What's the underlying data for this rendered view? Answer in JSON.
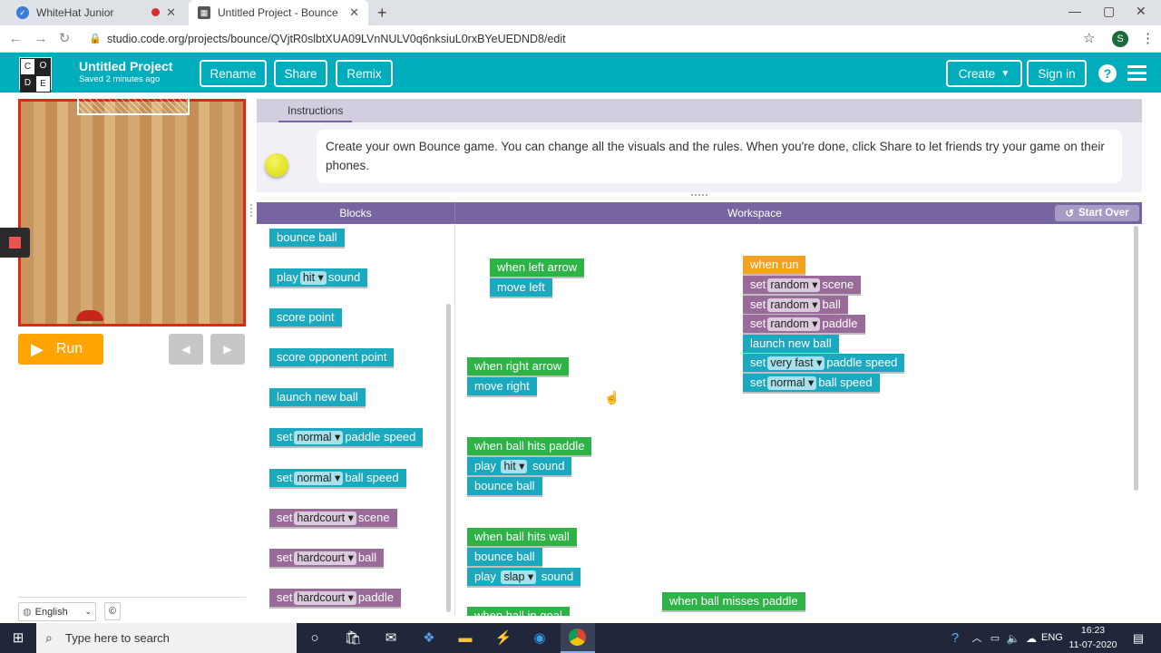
{
  "browser": {
    "tabs": [
      {
        "title": "WhiteHat Junior",
        "recording_dot": true
      },
      {
        "title": "Untitled Project - Bounce"
      }
    ],
    "url": "studio.code.org/projects/bounce/QVjtR0slbtXUA09LVnNULV0q6nksiuL0rxBYeUEDND8/edit",
    "profile_initial": "S"
  },
  "header": {
    "logo_letters": [
      "C",
      "O",
      "D",
      "E"
    ],
    "project_title": "Untitled Project",
    "saved_status": "Saved 2 minutes ago",
    "rename_label": "Rename",
    "share_label": "Share",
    "remix_label": "Remix",
    "create_label": "Create",
    "signin_label": "Sign in"
  },
  "game": {
    "run_label": "Run"
  },
  "instructions": {
    "tab_label": "Instructions",
    "text": "Create your own Bounce game. You can change all the visuals and the rules. When you're done, click Share to let friends try your game on their phones."
  },
  "panels": {
    "blocks_label": "Blocks",
    "workspace_label": "Workspace",
    "start_over_label": "Start Over"
  },
  "toolbox": [
    {
      "pre": "bounce ball",
      "dd": "",
      "post": "",
      "color": "teal"
    },
    {
      "pre": "play",
      "dd": "hit",
      "post": "sound",
      "color": "teal"
    },
    {
      "pre": "score point",
      "dd": "",
      "post": "",
      "color": "teal"
    },
    {
      "pre": "score opponent point",
      "dd": "",
      "post": "",
      "color": "teal"
    },
    {
      "pre": "launch new ball",
      "dd": "",
      "post": "",
      "color": "teal"
    },
    {
      "pre": "set",
      "dd": "normal",
      "post": "paddle speed",
      "color": "teal"
    },
    {
      "pre": "set",
      "dd": "normal",
      "post": "ball speed",
      "color": "teal"
    },
    {
      "pre": "set",
      "dd": "hardcourt",
      "post": "scene",
      "color": "purple"
    },
    {
      "pre": "set",
      "dd": "hardcourt",
      "post": "ball",
      "color": "purple"
    },
    {
      "pre": "set",
      "dd": "hardcourt",
      "post": "paddle",
      "color": "purple"
    }
  ],
  "workspace": {
    "left_arrow": {
      "event": "when left arrow",
      "action": "move left"
    },
    "right_arrow": {
      "event": "when right arrow",
      "action": "move right"
    },
    "run": {
      "event": "when run",
      "steps": [
        {
          "pre": "set",
          "dd": "random",
          "post": "scene",
          "color": "purple"
        },
        {
          "pre": "set",
          "dd": "random",
          "post": "ball",
          "color": "purple"
        },
        {
          "pre": "set",
          "dd": "random",
          "post": "paddle",
          "color": "purple"
        },
        {
          "pre": "launch new ball",
          "dd": "",
          "post": "",
          "color": "teal"
        },
        {
          "pre": "set",
          "dd": "very fast",
          "post": "paddle speed",
          "color": "teal"
        },
        {
          "pre": "set",
          "dd": "normal",
          "post": "ball speed",
          "color": "teal"
        }
      ]
    },
    "hits_paddle": {
      "event": "when ball hits paddle",
      "play_pre": "play",
      "play_dd": "hit",
      "play_post": "sound",
      "bounce": "bounce ball"
    },
    "hits_wall": {
      "event": "when ball hits wall",
      "bounce": "bounce ball",
      "play_pre": "play",
      "play_dd": "slap",
      "play_post": "sound"
    },
    "in_goal": {
      "event": "when ball in goal"
    },
    "misses_paddle": {
      "event": "when ball misses paddle"
    }
  },
  "footer": {
    "language": "English",
    "copyright": "©"
  },
  "taskbar": {
    "search_placeholder": "Type here to search",
    "lang": "ENG",
    "time": "16:23",
    "date": "11-07-2020"
  }
}
